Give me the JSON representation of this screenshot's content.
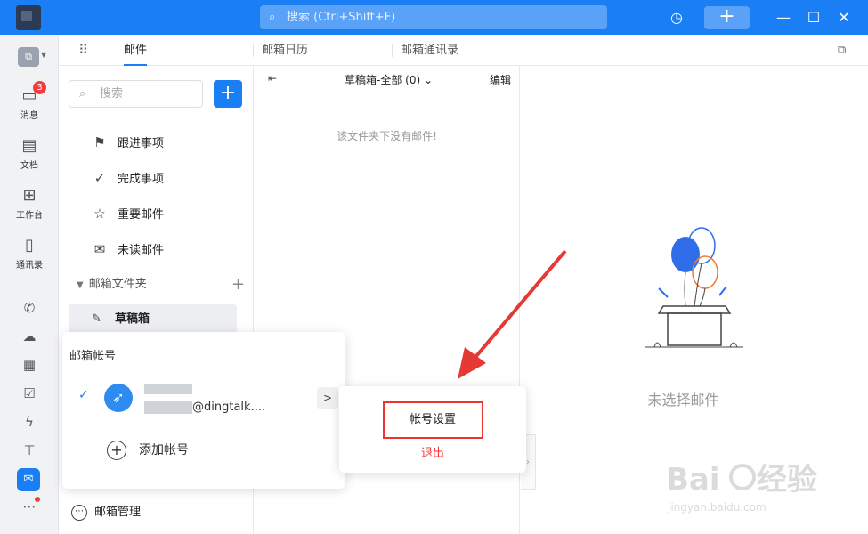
{
  "titlebar": {
    "search_placeholder": "搜索 (Ctrl+Shift+F)"
  },
  "rail": {
    "items": [
      {
        "label": "消息",
        "badge": "3"
      },
      {
        "label": "文档"
      },
      {
        "label": "工作台"
      },
      {
        "label": "通讯录"
      }
    ]
  },
  "tabs": [
    {
      "label": "邮件",
      "active": true
    },
    {
      "label": "邮箱日历"
    },
    {
      "label": "邮箱通讯录"
    }
  ],
  "sidebar": {
    "search_placeholder": "搜索",
    "items": [
      {
        "label": "跟进事项",
        "icon": "flag-icon"
      },
      {
        "label": "完成事项",
        "icon": "check-circle-icon"
      },
      {
        "label": "重要邮件",
        "icon": "star-icon"
      },
      {
        "label": "未读邮件",
        "icon": "envelope-icon"
      }
    ],
    "folders_header": "邮箱文件夹",
    "drafts": "草稿箱",
    "mail_manage": "邮箱管理"
  },
  "maillist": {
    "folder": "草稿箱-全部 (0)",
    "edit": "编辑",
    "empty": "该文件夹下没有邮件!"
  },
  "reader": {
    "empty": "未选择邮件"
  },
  "account_popup": {
    "title": "邮箱帐号",
    "email_suffix": "@dingtalk....",
    "add_account": "添加帐号"
  },
  "account_submenu": {
    "settings": "帐号设置",
    "logout": "退出"
  },
  "colors": {
    "brand": "#1a7ef5",
    "danger": "#ee3333"
  }
}
